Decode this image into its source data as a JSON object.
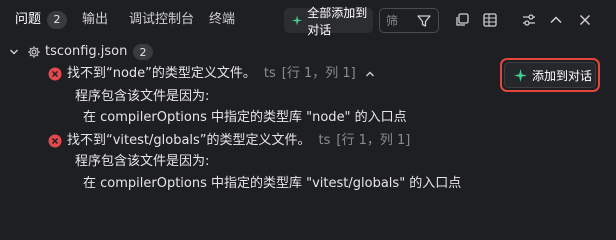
{
  "tabs": [
    {
      "label": "问题",
      "badge": "2"
    },
    {
      "label": "输出"
    },
    {
      "label": "调试控制台"
    },
    {
      "label": "终端"
    }
  ],
  "toolbar": {
    "add_all_label": "全部添加到对话",
    "filter_placeholder": "筛"
  },
  "file": {
    "name": "tsconfig.json",
    "count": "2"
  },
  "problems": [
    {
      "message": "找不到“node”的类型定义文件。",
      "source": "ts",
      "location": "[行 1，列 1]",
      "detail_heading": "程序包含该文件是因为:",
      "detail_line": "在 compilerOptions 中指定的类型库 \"node\" 的入口点"
    },
    {
      "message": "找不到“vitest/globals”的类型定义文件。",
      "source": "ts",
      "location": "[行 1，列 1]",
      "detail_heading": "程序包含该文件是因为:",
      "detail_line": "在 compilerOptions 中指定的类型库 \"vitest/globals\" 的入口点"
    }
  ],
  "add_to_chat_label": "添加到对话",
  "colors": {
    "background": "#1e1f22",
    "error": "#e5484d",
    "spark": "#3ecf8e",
    "highlight": "#e2463c"
  },
  "icons": [
    "sparkle-icon",
    "filter-icon",
    "copy-icon",
    "collapse-all-icon",
    "settings-sliders-icon",
    "chevron-up-icon",
    "close-icon",
    "chevron-down-icon",
    "gear-icon",
    "error-icon"
  ]
}
